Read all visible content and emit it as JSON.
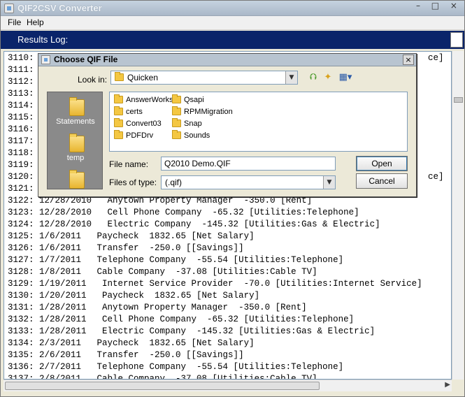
{
  "window": {
    "title": "QIF2CSV Converter",
    "controls": "– □ ×"
  },
  "menu": [
    {
      "label": "File"
    },
    {
      "label": "Help"
    }
  ],
  "results": {
    "header": "Results Log:"
  },
  "log_lines": [
    {
      "num": "3110:",
      "text": ""
    },
    {
      "num": "3111:",
      "text": ""
    },
    {
      "num": "3112:",
      "text": ""
    },
    {
      "num": "3113:",
      "text": ""
    },
    {
      "num": "3114:",
      "text": ""
    },
    {
      "num": "3115:",
      "text": ""
    },
    {
      "num": "3116:",
      "text": ""
    },
    {
      "num": "3117:",
      "text": ""
    },
    {
      "num": "3118:",
      "text": ""
    },
    {
      "num": "3119:",
      "text": ""
    },
    {
      "num": "3120:",
      "text": ""
    },
    {
      "num": "3121:",
      "text": ""
    },
    {
      "num": "3122:",
      "text": " 12/28/2010   Anytown Property Manager  -350.0 [Rent]"
    },
    {
      "num": "3123:",
      "text": " 12/28/2010   Cell Phone Company  -65.32 [Utilities:Telephone]"
    },
    {
      "num": "3124:",
      "text": " 12/28/2010   Electric Company  -145.32 [Utilities:Gas & Electric]"
    },
    {
      "num": "3125:",
      "text": " 1/6/2011   Paycheck  1832.65 [Net Salary]"
    },
    {
      "num": "3126:",
      "text": " 1/6/2011   Transfer  -250.0 [[Savings]]"
    },
    {
      "num": "3127:",
      "text": " 1/7/2011   Telephone Company  -55.54 [Utilities:Telephone]"
    },
    {
      "num": "3128:",
      "text": " 1/8/2011   Cable Company  -37.08 [Utilities:Cable TV]"
    },
    {
      "num": "3129:",
      "text": " 1/19/2011   Internet Service Provider  -70.0 [Utilities:Internet Service]"
    },
    {
      "num": "3130:",
      "text": " 1/20/2011   Paycheck  1832.65 [Net Salary]"
    },
    {
      "num": "3131:",
      "text": " 1/28/2011   Anytown Property Manager  -350.0 [Rent]"
    },
    {
      "num": "3132:",
      "text": " 1/28/2011   Cell Phone Company  -65.32 [Utilities:Telephone]"
    },
    {
      "num": "3133:",
      "text": " 1/28/2011   Electric Company  -145.32 [Utilities:Gas & Electric]"
    },
    {
      "num": "3134:",
      "text": " 2/3/2011   Paycheck  1832.65 [Net Salary]"
    },
    {
      "num": "3135:",
      "text": " 2/6/2011   Transfer  -250.0 [[Savings]]"
    },
    {
      "num": "3136:",
      "text": " 2/7/2011   Telephone Company  -55.54 [Utilities:Telephone]"
    },
    {
      "num": "3137:",
      "text": " 2/8/2011   Cable Company  -37.08 [Utilities:Cable TV]"
    }
  ],
  "right_edge_fragments": {
    "line3110": "ce]",
    "line3120": "ce]"
  },
  "dialog": {
    "title": "Choose QIF File",
    "close": "×",
    "look_in_label": "Look in:",
    "look_in_value": "Quicken",
    "tools": {
      "up": "up-folder-icon",
      "new_folder": "new-folder-icon",
      "view": "view-menu-icon"
    },
    "places": [
      {
        "label": "Statements"
      },
      {
        "label": "temp"
      },
      {
        "label": ""
      }
    ],
    "files": [
      {
        "name": "AnswerWorks"
      },
      {
        "name": "certs"
      },
      {
        "name": "Convert03"
      },
      {
        "name": "PDFDrv"
      },
      {
        "name": "Qsapi"
      },
      {
        "name": "RPMMigration"
      },
      {
        "name": "Snap"
      },
      {
        "name": "Sounds"
      }
    ],
    "file_name_label": "File name:",
    "file_name_value": "Q2010 Demo.QIF",
    "files_of_type_label": "Files of type:",
    "files_of_type_value": "(.qif)",
    "open_label": "Open",
    "cancel_label": "Cancel"
  }
}
